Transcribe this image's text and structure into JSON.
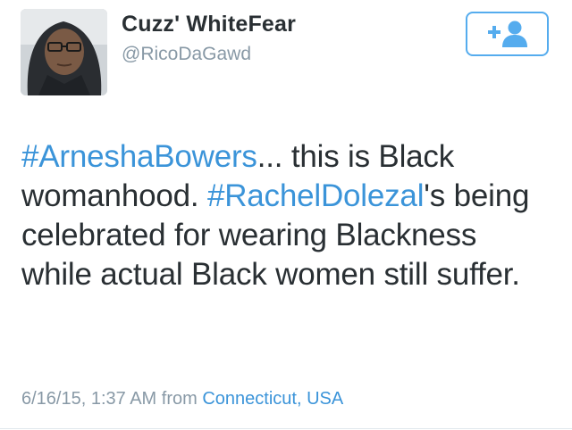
{
  "user": {
    "display_name": "Cuzz' WhiteFear",
    "handle": "@RicoDaGawd"
  },
  "follow_button": {
    "icon": "add-person-icon",
    "label": "+"
  },
  "tweet": {
    "segments": [
      {
        "type": "hashtag",
        "text": "#ArneshaBowers"
      },
      {
        "type": "text",
        "text": "... this is Black womanhood. "
      },
      {
        "type": "hashtag",
        "text": "#RachelDolezal"
      },
      {
        "type": "text",
        "text": "'s being celebrated for wearing Blackness while actual Black women still suffer."
      }
    ]
  },
  "meta": {
    "timestamp": "6/16/15, 1:37 AM",
    "from_label": "from",
    "location": "Connecticut, USA"
  },
  "colors": {
    "link": "#3b94d9",
    "secondary_text": "#8899a6",
    "primary_text": "#292f33",
    "follow_border": "#55acee"
  }
}
